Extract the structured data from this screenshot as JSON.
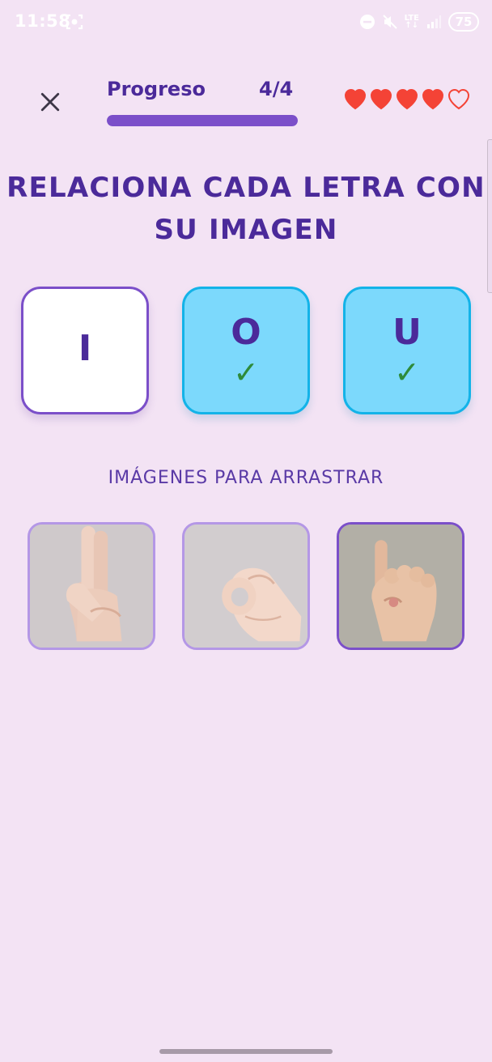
{
  "status_bar": {
    "time": "11:58",
    "network": "LTE",
    "network_sub": "↑↓",
    "battery": "75"
  },
  "header": {
    "progress_label": "Progreso",
    "progress_count": "4/4",
    "progress_fraction": 1.0,
    "lives_total": 5,
    "lives_remaining": 4,
    "heart_color": "#f44336"
  },
  "title": "RELACIONA CADA LETRA CON SU IMAGEN",
  "letters": [
    {
      "letter": "I",
      "matched": false,
      "check": ""
    },
    {
      "letter": "O",
      "matched": true,
      "check": "✓"
    },
    {
      "letter": "U",
      "matched": true,
      "check": "✓"
    }
  ],
  "images_subtitle": "IMÁGENES PARA ARRASTRAR",
  "images": [
    {
      "icon": "hand-sign-u-icon",
      "selected": false
    },
    {
      "icon": "hand-sign-o-icon",
      "selected": false
    },
    {
      "icon": "hand-sign-i-icon",
      "selected": true
    }
  ],
  "colors": {
    "background": "#f3e3f4",
    "primary": "#4b2a9a",
    "accent": "#7b4fc9",
    "matched_fill": "#7cd9fc",
    "matched_border": "#13b3e8",
    "check": "#2e8b3a"
  }
}
